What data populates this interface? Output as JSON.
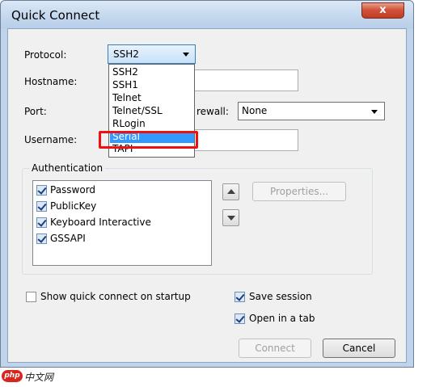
{
  "window": {
    "title": "Quick Connect",
    "close_glyph": "x"
  },
  "form": {
    "protocol_label": "Protocol:",
    "protocol_value": "SSH2",
    "hostname_label": "Hostname:",
    "port_label": "Port:",
    "firewall_label": "rewall:",
    "firewall_value": "None",
    "username_label": "Username:"
  },
  "protocol_dropdown": {
    "options": [
      "SSH2",
      "SSH1",
      "Telnet",
      "Telnet/SSL",
      "RLogin",
      "Serial",
      "TAPI"
    ],
    "highlighted": "Serial",
    "highlight_color": "#3399ff",
    "annotation_color": "#ee1111"
  },
  "authentication": {
    "legend": "Authentication",
    "methods": [
      {
        "label": "Password",
        "checked": true
      },
      {
        "label": "PublicKey",
        "checked": true
      },
      {
        "label": "Keyboard Interactive",
        "checked": true
      },
      {
        "label": "GSSAPI",
        "checked": true
      }
    ],
    "properties_button": "Properties...",
    "move_up_icon": "arrow-up-icon",
    "move_down_icon": "arrow-down-icon"
  },
  "options": {
    "show_on_startup_label": "Show quick connect on startup",
    "show_on_startup_checked": false,
    "save_session_label": "Save session",
    "save_session_checked": true,
    "open_in_tab_label": "Open in a tab",
    "open_in_tab_checked": true
  },
  "buttons": {
    "connect": "Connect",
    "cancel": "Cancel"
  },
  "watermark": {
    "logo": "php",
    "text": "中文网"
  }
}
